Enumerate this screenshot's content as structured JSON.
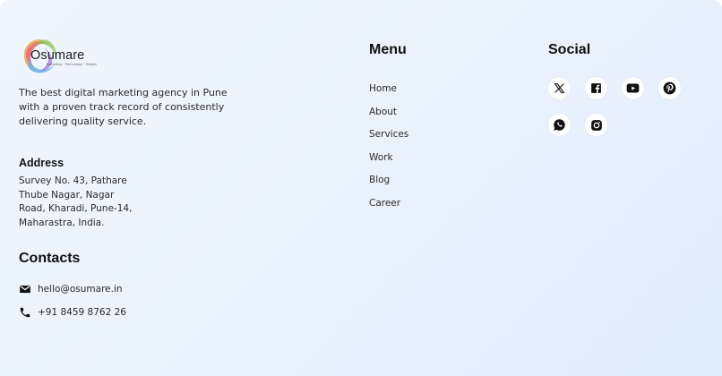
{
  "brand": {
    "name": "Osumare",
    "wordmark": "Osumare",
    "tagline_small": "Marketing · Technology · Design",
    "description": "The best digital marketing agency in Pune with a proven track record of consistently delivering quality service."
  },
  "address": {
    "heading": "Address",
    "lines": [
      "Survey No. 43, Pathare",
      "Thube Nagar, Nagar",
      "Road, Kharadi, Pune-14,",
      "Maharastra, India."
    ]
  },
  "contacts": {
    "heading": "Contacts",
    "email": "hello@osumare.in",
    "phone": "+91 8459 8762 26"
  },
  "menu": {
    "heading": "Menu",
    "items": [
      "Home",
      "About",
      "Services",
      "Work",
      "Blog",
      "Career"
    ]
  },
  "social": {
    "heading": "Social",
    "icons": [
      "x-icon",
      "facebook-icon",
      "youtube-icon",
      "pinterest-icon",
      "whatsapp-icon",
      "instagram-icon"
    ]
  },
  "colors": {
    "background_start": "#f0f6fd",
    "background_end": "#e2edfb",
    "icon_circle": "#ffffff",
    "text_dark": "#111111"
  }
}
